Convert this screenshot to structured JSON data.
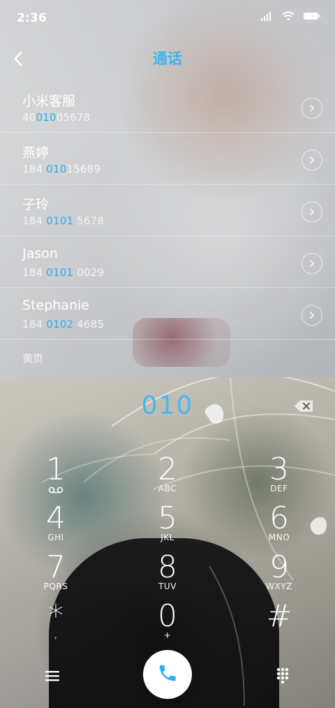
{
  "status_bar": {
    "time": "2:36",
    "icons": [
      "signal-icon",
      "wifi-icon",
      "battery-icon"
    ]
  },
  "header": {
    "title": "通话",
    "back_icon": "chevron-left-icon"
  },
  "contacts": [
    {
      "name": "小米客服",
      "number_pre": "40",
      "number_hl": "010",
      "number_post": "05678"
    },
    {
      "name": "燕婷",
      "number_pre": "184 ",
      "number_hl": "010",
      "number_post": "15689"
    },
    {
      "name": "子玲",
      "number_pre": "184 ",
      "number_hl": "0101",
      "number_post": " 5678"
    },
    {
      "name": "Jason",
      "number_pre": "184 ",
      "number_hl": "0101",
      "number_post": " 0029"
    },
    {
      "name": "Stephanie",
      "number_pre": "184 ",
      "number_hl": "0102",
      "number_post": " 4685"
    }
  ],
  "yellow_pages_label": "黄页",
  "dial": {
    "input_value": "010",
    "delete_icon": "backspace-icon"
  },
  "keypad": [
    {
      "digit": "1",
      "letters": "",
      "icon": "voicemail-icon"
    },
    {
      "digit": "2",
      "letters": "ABC"
    },
    {
      "digit": "3",
      "letters": "DEF"
    },
    {
      "digit": "4",
      "letters": "GHI"
    },
    {
      "digit": "5",
      "letters": "JKL"
    },
    {
      "digit": "6",
      "letters": "MNO"
    },
    {
      "digit": "7",
      "letters": "PQRS"
    },
    {
      "digit": "8",
      "letters": "TUV"
    },
    {
      "digit": "9",
      "letters": "WXYZ"
    },
    {
      "digit": "*",
      "letters": ","
    },
    {
      "digit": "0",
      "letters": "+"
    },
    {
      "digit": "#",
      "letters": ""
    }
  ],
  "bottom_bar": {
    "menu_icon": "menu-icon",
    "call_icon": "phone-icon",
    "dialpad_icon": "dialpad-icon",
    "accent_color": "#2ab0f0"
  }
}
